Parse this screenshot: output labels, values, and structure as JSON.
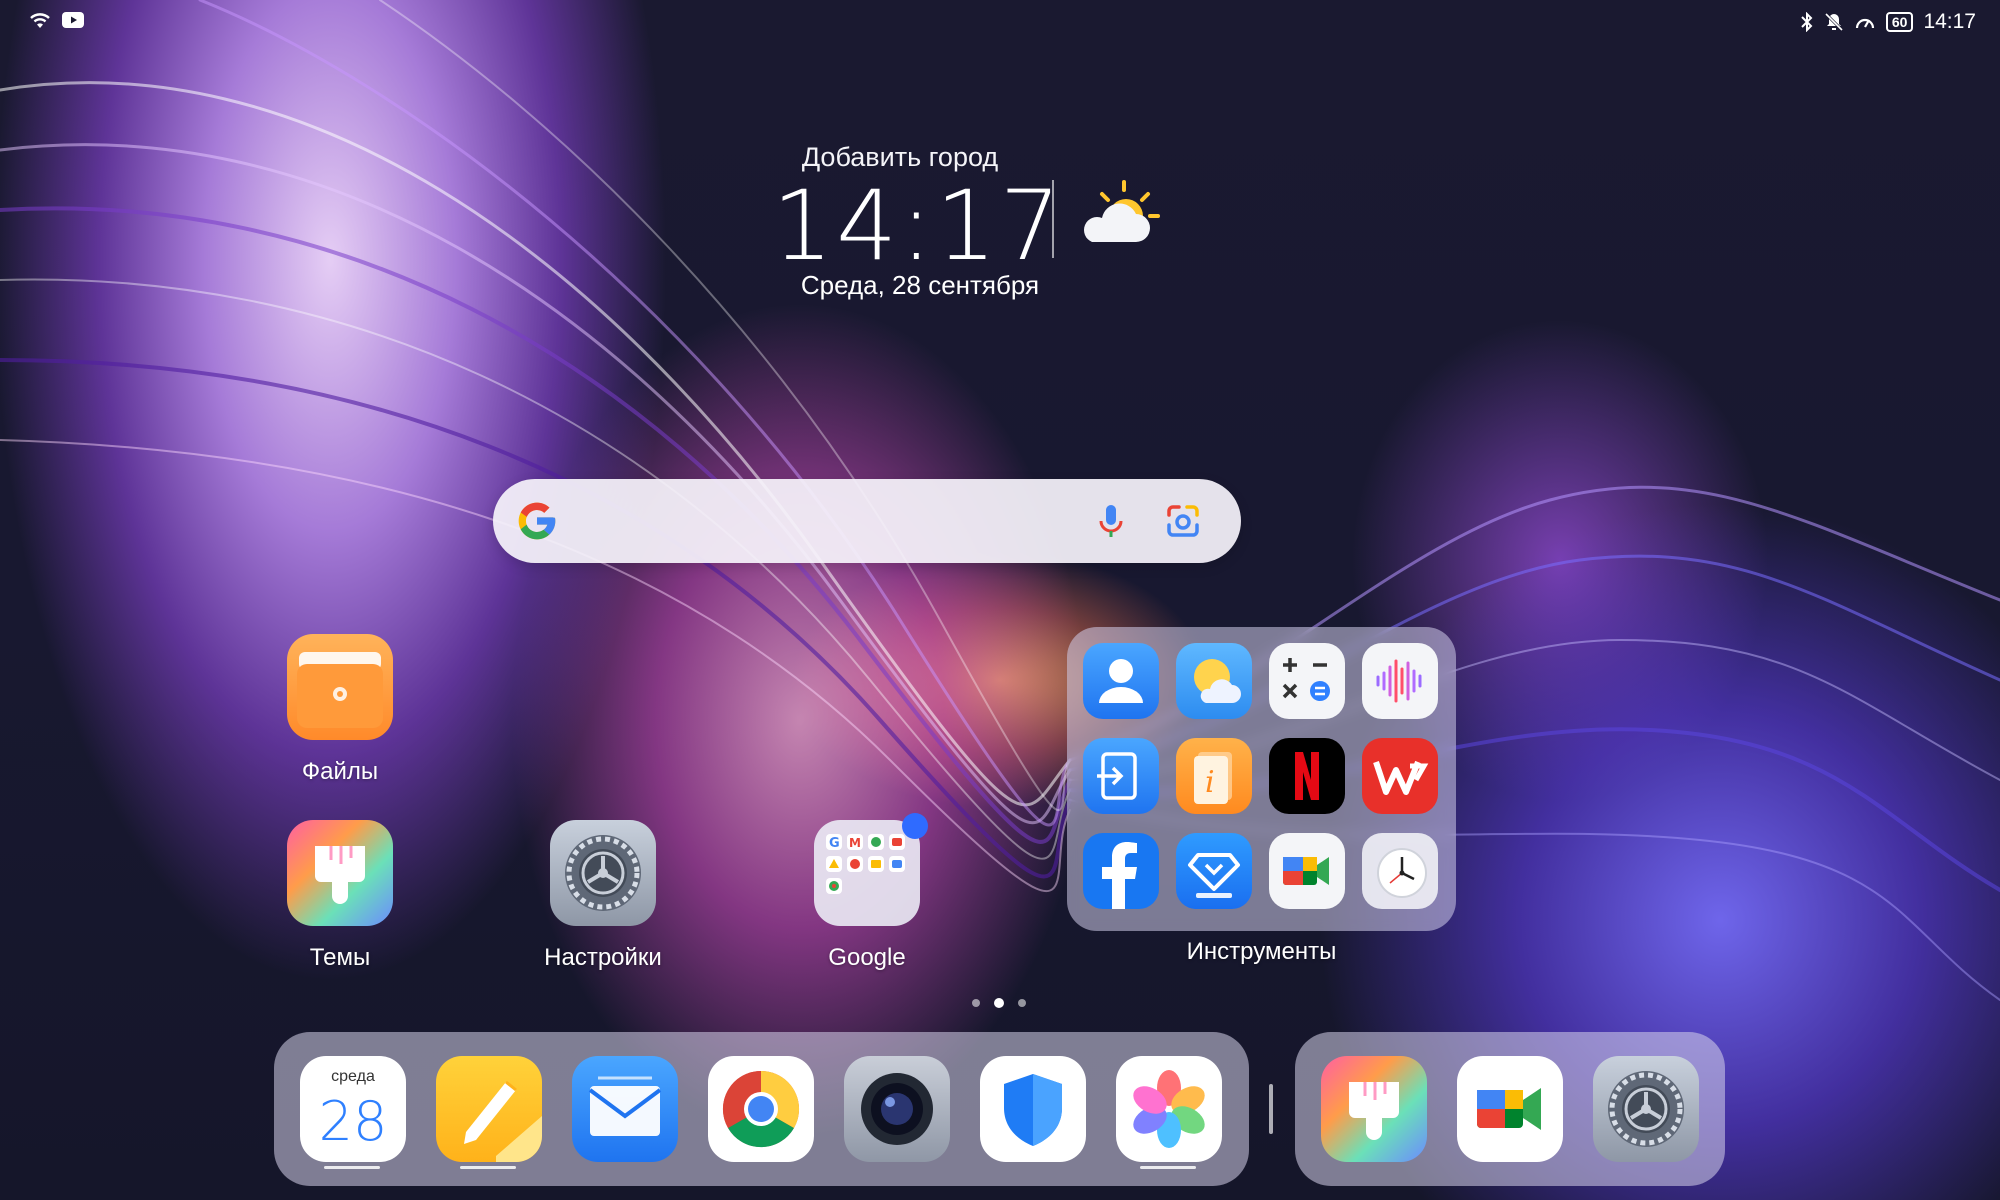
{
  "status_bar": {
    "time": "14:17",
    "battery": "60"
  },
  "clock_widget": {
    "city": "Добавить город",
    "time": "14:17",
    "date": "Среда, 28 сентября"
  },
  "search": {
    "placeholder": ""
  },
  "apps": {
    "files": "Файлы",
    "themes": "Темы",
    "settings": "Настройки",
    "google": "Google"
  },
  "folder": {
    "label": "Инструменты"
  },
  "dock": {
    "calendar_day": "среда",
    "calendar_date": "28"
  },
  "colors": {
    "accent_blue": "#2f6bff",
    "google_blue": "#4285F4",
    "google_red": "#EA4335",
    "google_yellow": "#FBBC05",
    "google_green": "#34A853"
  }
}
